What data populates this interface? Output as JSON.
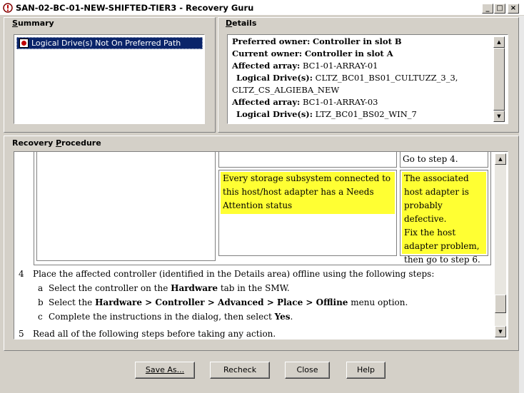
{
  "window": {
    "title": "SAN-02-BC-01-NEW-SHIFTED-TIER3 - Recovery Guru",
    "minimize": "_",
    "maximize": "□",
    "close": "×"
  },
  "summary": {
    "label": "Summary",
    "items": [
      "Logical Drive(s) Not On Preferred Path"
    ]
  },
  "details": {
    "label": "Details",
    "lines": [
      {
        "label": "Preferred owner:",
        "value": "Controller in slot B"
      },
      {
        "label": "Current owner:",
        "value": "Controller in slot A"
      },
      {
        "label": "Affected array:",
        "value": "BC1-01-ARRAY-01"
      },
      {
        "label": "Logical Drive(s):",
        "value": "CLTZ_BC01_BS01_CULTUZZ_3_3,"
      },
      {
        "label": "",
        "value": "CLTZ_CS_ALGIEBA_NEW"
      },
      {
        "label": "Affected array:",
        "value": "BC1-01-ARRAY-03"
      },
      {
        "label": "Logical Drive(s):",
        "value": "LTZ_BC01_BS02_WIN_7"
      }
    ]
  },
  "procedure": {
    "label": "Recovery Procedure",
    "table": {
      "top_right": "Go to step 4.",
      "condition_lines": [
        "Every storage subsystem connected to",
        "this host/host adapter has a Needs",
        "Attention status"
      ],
      "action_lines": [
        "The associated",
        "host adapter is",
        "probably defective.",
        "Fix the host",
        "adapter problem,",
        "then go to step 6."
      ]
    },
    "step4": {
      "num": "4",
      "text": "Place the affected controller (identified in the Details area) offline using the following steps:",
      "a_letter": "a",
      "a_pre": "Select the controller on the ",
      "a_bold": "Hardware",
      "a_post": " tab in the SMW.",
      "b_letter": "b",
      "b_pre": "Select the ",
      "b_bold": "Hardware > Controller > Advanced > Place > Offline",
      "b_post": " menu option.",
      "c_letter": "c",
      "c_pre": "Complete the instructions in the dialog, then select ",
      "c_bold": "Yes",
      "c_post": "."
    },
    "step5": {
      "num": "5",
      "text": "Read all of the following steps before taking any action."
    }
  },
  "buttons": {
    "save_as": "Save As...",
    "recheck": "Recheck",
    "close": "Close",
    "help": "Help"
  },
  "colors": {
    "selection": "#0a246a",
    "highlight": "#ffff33",
    "face": "#d4d0c8"
  }
}
